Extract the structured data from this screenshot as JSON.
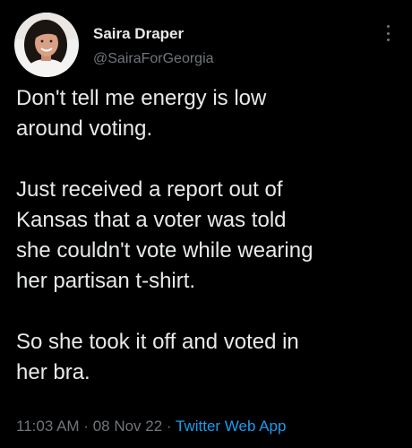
{
  "author": {
    "display_name": "Saira Draper",
    "handle": "@SairaForGeorgia"
  },
  "tweet": {
    "paragraphs": [
      "Don't tell me energy is low\naround voting.",
      "Just received a report out of\nKansas that a voter was told\nshe couldn't vote while wearing\nher partisan t-shirt.",
      "So she took it off and voted in\nher bra."
    ]
  },
  "meta": {
    "time": "11:03 AM",
    "separator": " · ",
    "date": "08 Nov 22",
    "source": "Twitter Web App"
  },
  "icons": {
    "more": "more-options-icon",
    "avatar": "profile-photo"
  },
  "colors": {
    "background": "#000000",
    "text": "#e7e9ea",
    "secondary_text": "#71767b",
    "link": "#1d9bf0"
  }
}
